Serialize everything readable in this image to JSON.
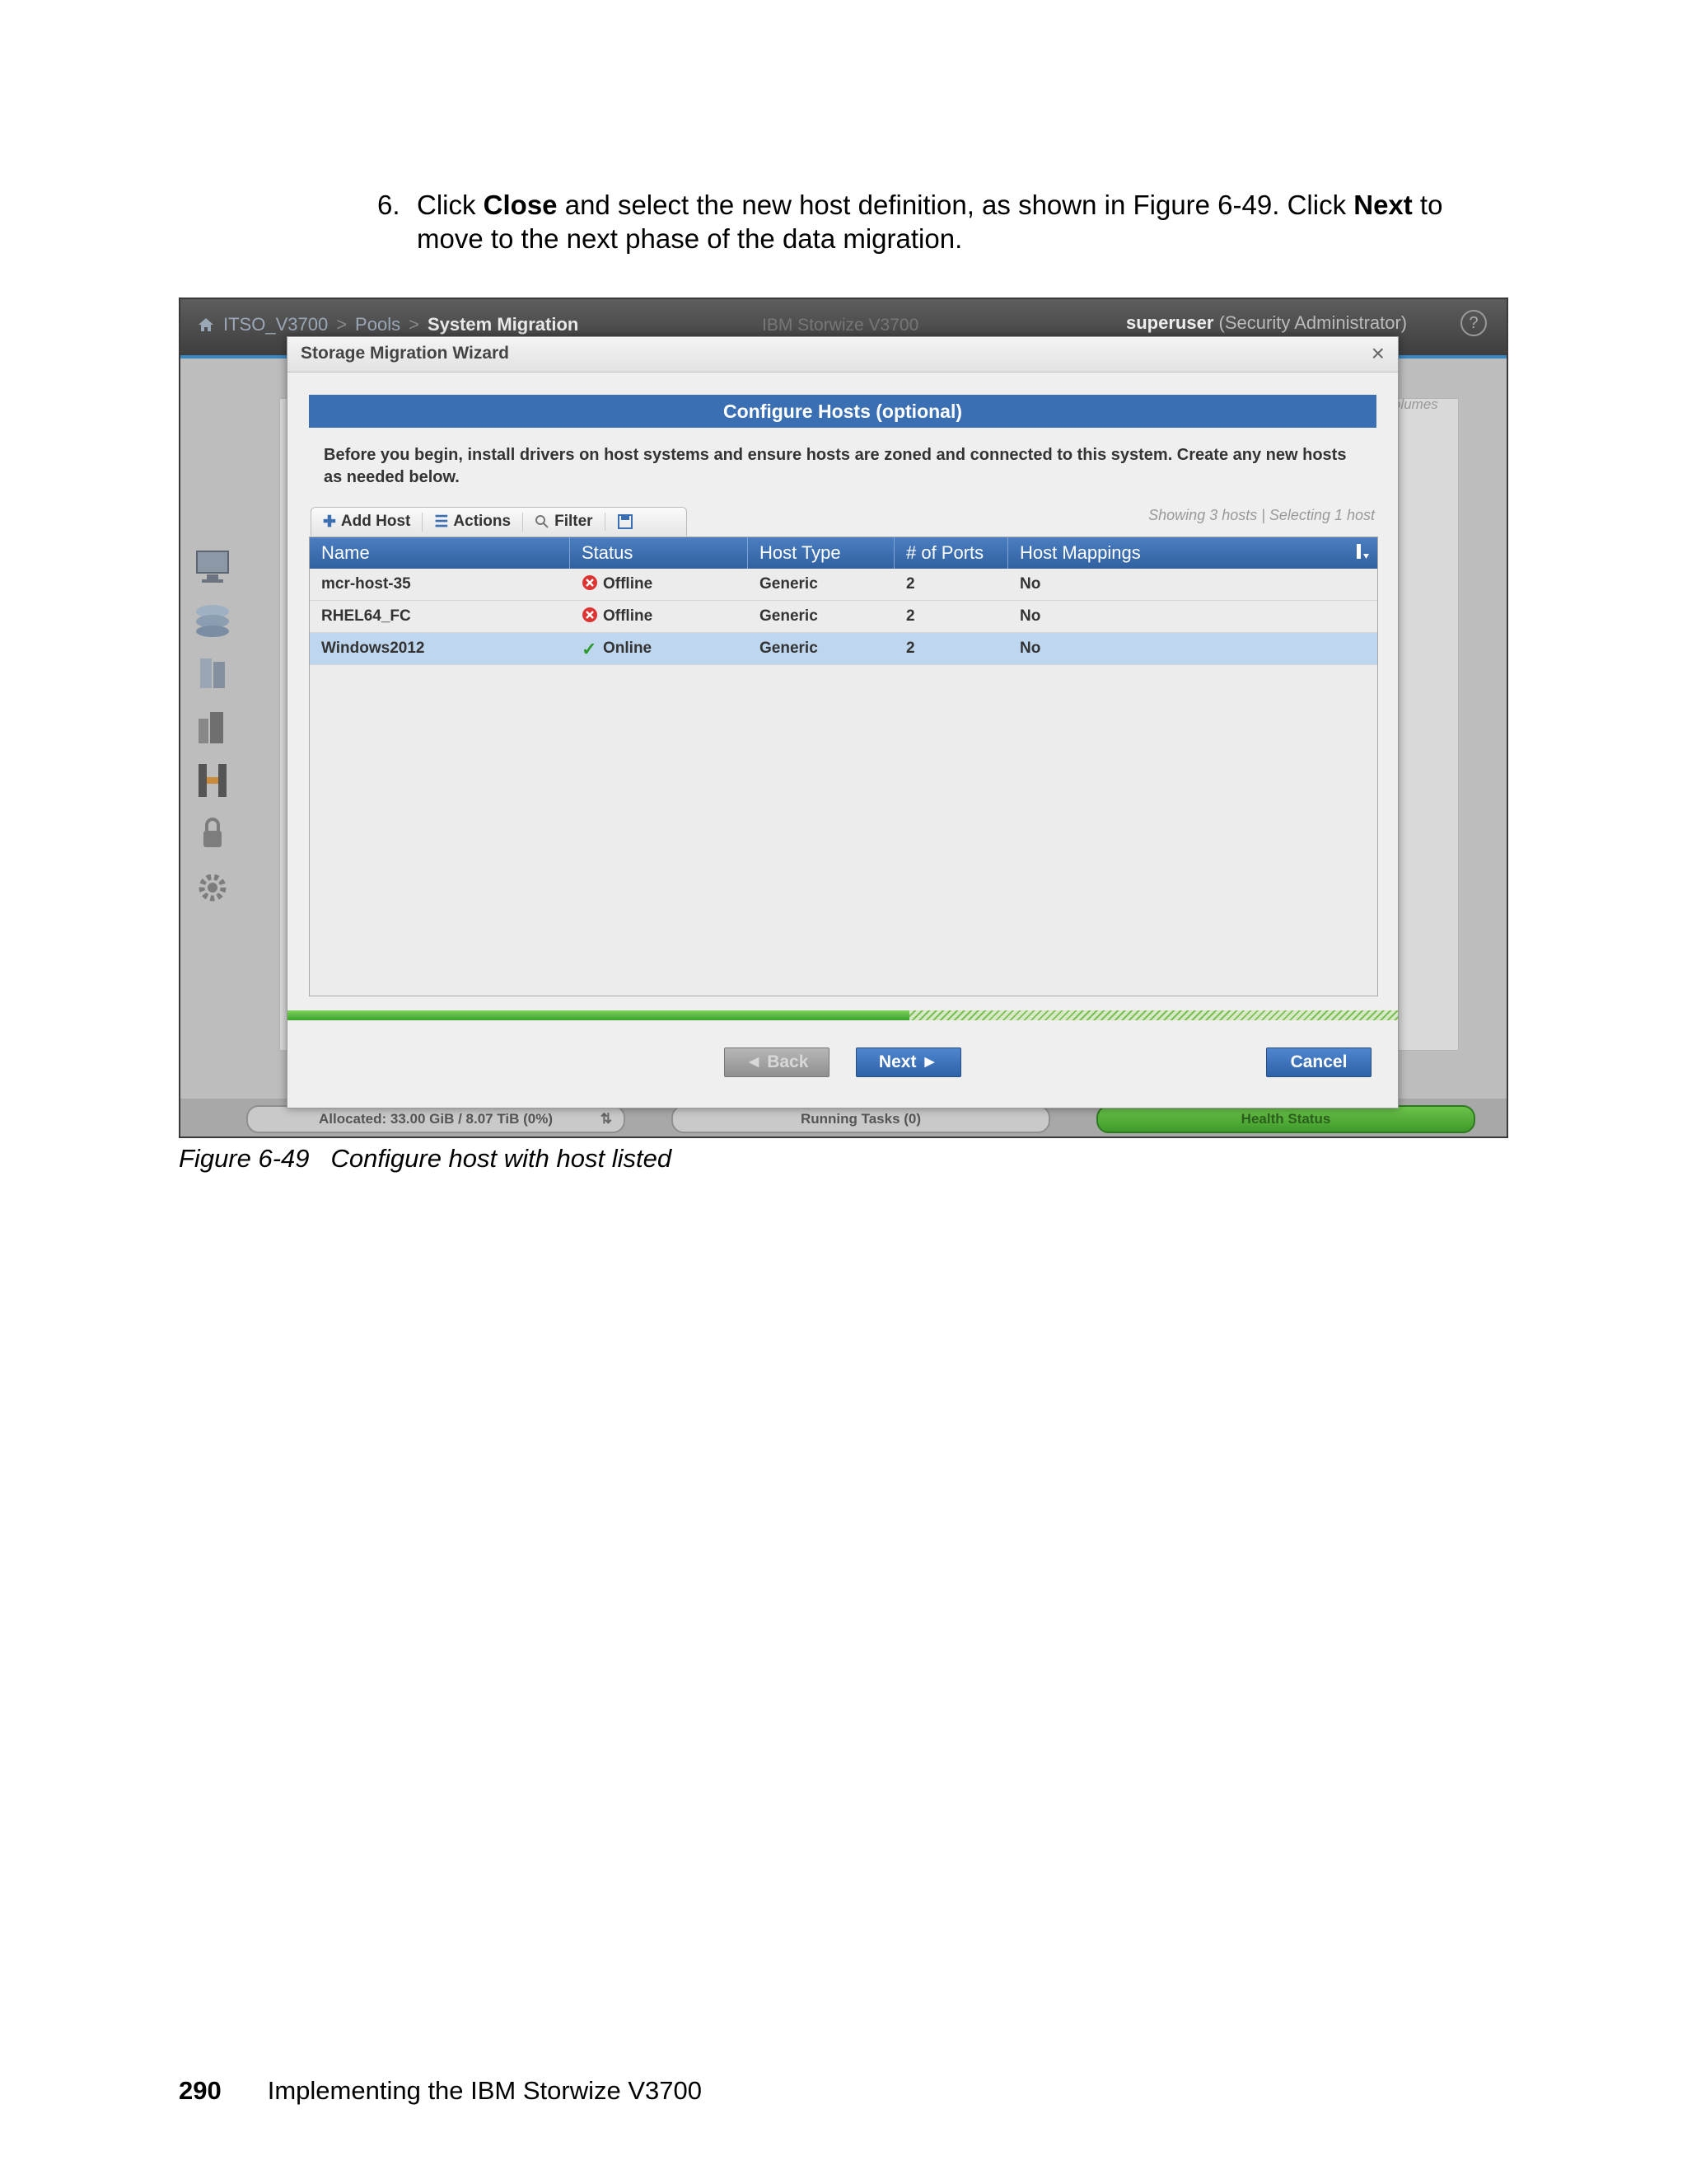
{
  "step": {
    "number": "6.",
    "text_1": "Click ",
    "bold_1": "Close",
    "text_2": " and select the new host definition, as shown in Figure 6-49. Click ",
    "bold_2": "Next",
    "text_3": " to move to the next phase of the data migration."
  },
  "app": {
    "breadcrumb": [
      "ITSO_V3700",
      "Pools",
      "System Migration"
    ],
    "breadcrumb_sep": ">",
    "product": "IBM Storwize V3700",
    "user": "superuser",
    "role": "(Security Administrator)",
    "help": "?",
    "bg_volumes_label": "olumes",
    "statusbar": {
      "allocated": "Allocated: 33.00 GiB / 8.07 TiB (0%)",
      "running_tasks": "Running Tasks (0)",
      "health": "Health Status"
    }
  },
  "wizard": {
    "title": "Storage Migration Wizard",
    "close": "×",
    "banner": "Configure Hosts (optional)",
    "intro": "Before you begin, install drivers on host systems and ensure hosts are zoned and connected to this system. Create any new hosts as needed below.",
    "toolbar": {
      "add_host": "Add Host",
      "actions": "Actions",
      "filter": "Filter"
    },
    "showing": "Showing 3 hosts | Selecting 1 host",
    "columns": [
      "Name",
      "Status",
      "Host Type",
      "# of Ports",
      "Host Mappings"
    ],
    "rows": [
      {
        "name": "mcr-host-35",
        "status": "Offline",
        "status_kind": "error",
        "host_type": "Generic",
        "ports": "2",
        "mappings": "No"
      },
      {
        "name": "RHEL64_FC",
        "status": "Offline",
        "status_kind": "error",
        "host_type": "Generic",
        "ports": "2",
        "mappings": "No"
      },
      {
        "name": "Windows2012",
        "status": "Online",
        "status_kind": "ok",
        "host_type": "Generic",
        "ports": "2",
        "mappings": "No",
        "selected": true
      }
    ],
    "progress_fraction": 0.56,
    "buttons": {
      "back": "◄ Back",
      "next": "Next ►",
      "cancel": "Cancel"
    }
  },
  "caption": {
    "label": "Figure 6-49",
    "text": "Configure host with host listed"
  },
  "footer": {
    "page_number": "290",
    "title": "Implementing the IBM Storwize V3700"
  }
}
